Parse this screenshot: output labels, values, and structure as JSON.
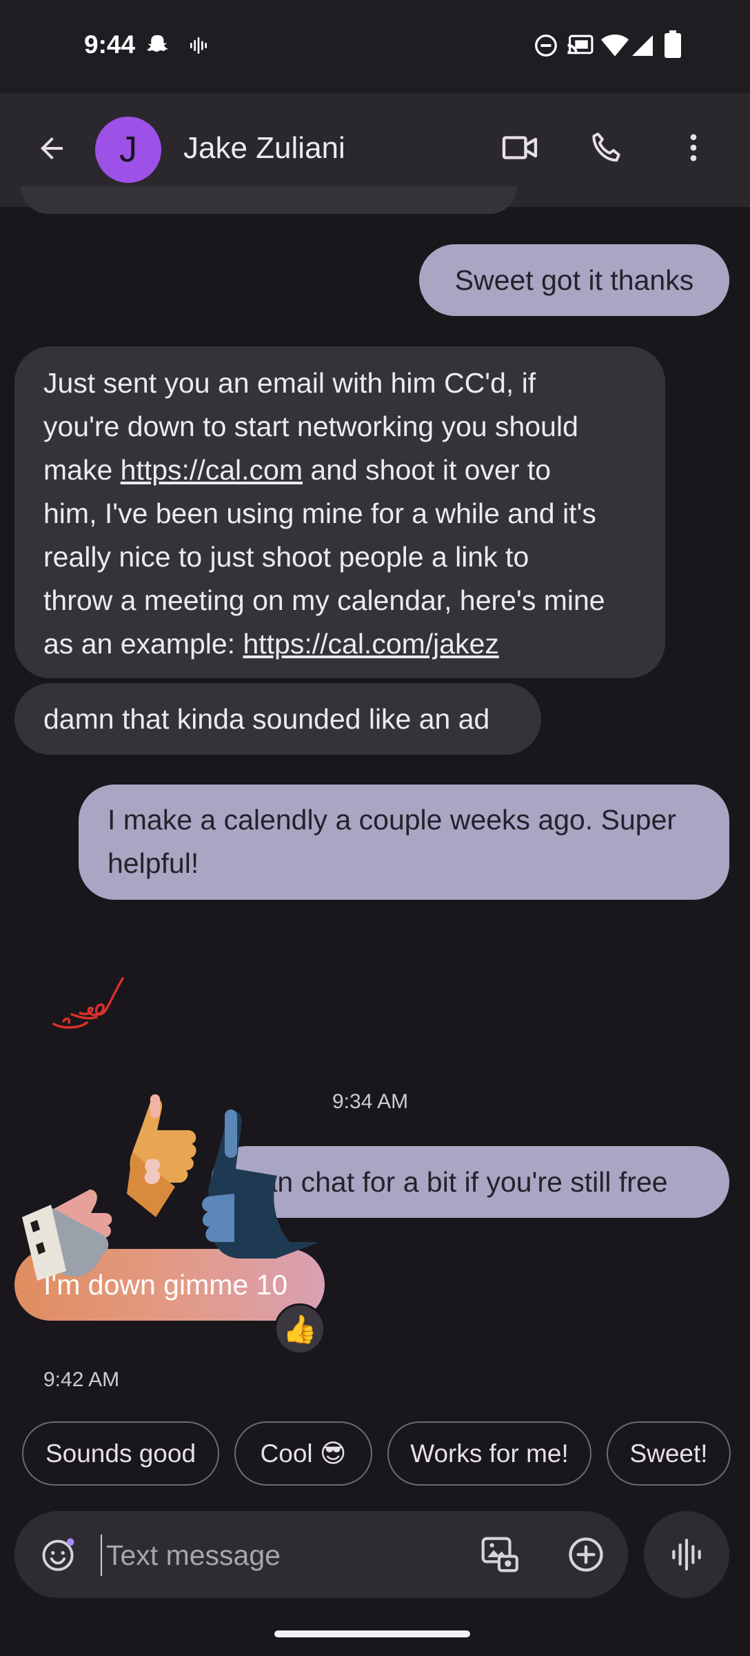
{
  "status_bar": {
    "time": "9:44",
    "icons": [
      "snapchat-icon",
      "voice-recording-icon",
      "do-not-disturb-icon",
      "cast-icon",
      "wifi-icon",
      "signal-icon",
      "battery-icon"
    ]
  },
  "header": {
    "avatar_initial": "J",
    "contact_name": "Jake Zuliani",
    "actions": [
      "video-call-icon",
      "phone-call-icon",
      "more-options-icon"
    ]
  },
  "messages": [
    {
      "direction": "sent",
      "text": "Sweet got it thanks"
    },
    {
      "direction": "received",
      "lines": [
        "Just sent you an email with him CC'd, if",
        "you're down to start networking you should",
        "make ",
        "https://cal.com",
        " and shoot it over to",
        "him, I've been using mine for a while and it's",
        "really nice to just shoot people a link to",
        "throw a meeting on my calendar, here's mine",
        "as an example: ",
        "https://cal.com/jakez"
      ]
    },
    {
      "direction": "received",
      "text": "damn that kinda sounded like an ad"
    },
    {
      "direction": "sent",
      "lines": [
        "I make a calendly a couple weeks ago. Super",
        "helpful!"
      ]
    },
    {
      "timestamp": "9:34 AM"
    },
    {
      "direction": "sent",
      "text": "Can chat for a bit if you're still free"
    },
    {
      "direction": "received",
      "text": "I'm down gimme 10",
      "reaction": "👍"
    },
    {
      "timestamp": "9:42 AM"
    }
  ],
  "smart_replies": [
    "Sounds good",
    "Cool 😎",
    "Works for me!",
    "Sweet!"
  ],
  "composer": {
    "placeholder": "Text message"
  },
  "colors": {
    "background": "#19171c",
    "received_bubble": "#35333a",
    "sent_bubble": "#a9a6c3",
    "avatar": "#9d51e6",
    "effect_bubble_start": "#e08d5f",
    "effect_bubble_end": "#d9a0b3"
  }
}
